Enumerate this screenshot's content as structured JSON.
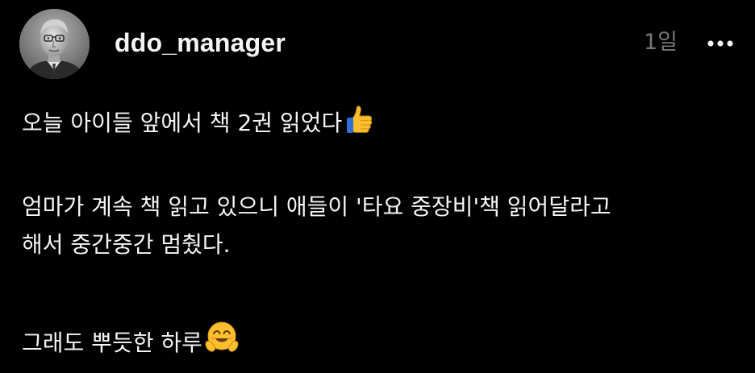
{
  "post": {
    "author": {
      "username": "ddo_manager",
      "avatar_icon": "profile-photo-avatar"
    },
    "timestamp": "1일",
    "more_icon": "ellipsis-icon",
    "lines": [
      "오늘 아이들 앞에서 책 2권 읽었다",
      "엄마가 계속 책 읽고 있으니 애들이 '타요 중장비'책 읽어달라고",
      "해서 중간중간 멈췄다.",
      "그래도 뿌듯한 하루"
    ],
    "emojis": {
      "first": "thumbs-up-emoji",
      "last": "hugging-face-emoji"
    }
  },
  "colors": {
    "background": "#000000",
    "text": "#f3f5f7",
    "muted": "#777777",
    "emoji_yellow": "#fdbf2d"
  }
}
